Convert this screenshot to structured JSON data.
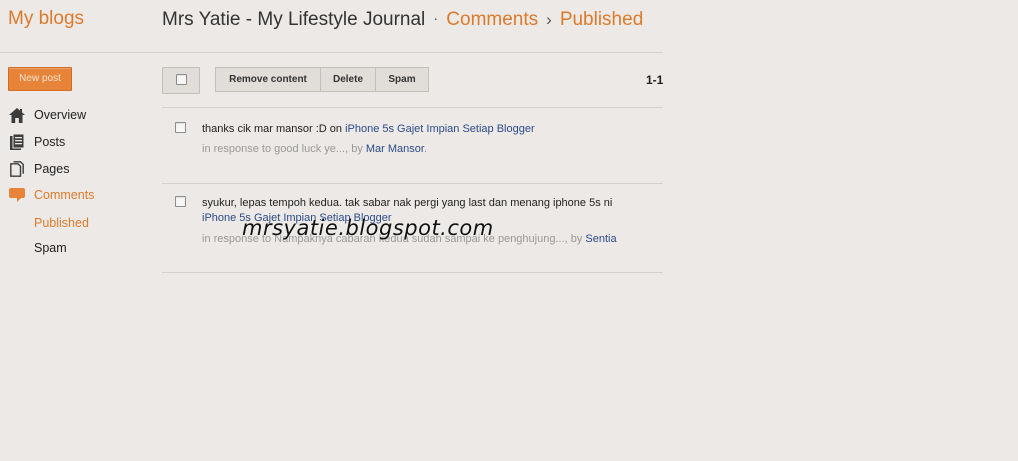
{
  "header": {
    "brand": "My blogs",
    "blog_title": "Mrs Yatie - My Lifestyle Journal",
    "sep1": "·",
    "crumb_comments": "Comments",
    "sep2": "›",
    "crumb_published": "Published"
  },
  "sidebar": {
    "new_post": "New post",
    "items": [
      {
        "label": "Overview",
        "icon": "house-icon"
      },
      {
        "label": "Posts",
        "icon": "posts-icon"
      },
      {
        "label": "Pages",
        "icon": "pages-icon"
      },
      {
        "label": "Comments",
        "icon": "comment-bubble-icon"
      }
    ],
    "subitems": [
      {
        "label": "Published"
      },
      {
        "label": "Spam"
      }
    ]
  },
  "toolbar": {
    "remove_content": "Remove content",
    "delete": "Delete",
    "spam": "Spam",
    "count": "1-1"
  },
  "comments": [
    {
      "text": "thanks cik mar mansor :D on ",
      "post_link": "iPhone 5s Gajet Impian Setiap Blogger",
      "meta_prefix": "in response to good luck ye..., by ",
      "author": "Mar Mansor",
      "meta_suffix": "."
    },
    {
      "text": "syukur, lepas tempoh kedua. tak sabar nak pergi yang last dan menang iphone 5s ni",
      "post_link": "iPhone 5s Gajet Impian Setiap Blogger",
      "meta_prefix": "in response to Nampaknya cabaran kedua sudah sampai ke penghujung..., by ",
      "author": "Sentia"
    }
  ],
  "watermark": "mrsyatie.blogspot.com",
  "colors": {
    "accent": "#dd7b2c",
    "link": "#2c4b8b",
    "background": "#ece9e6"
  }
}
